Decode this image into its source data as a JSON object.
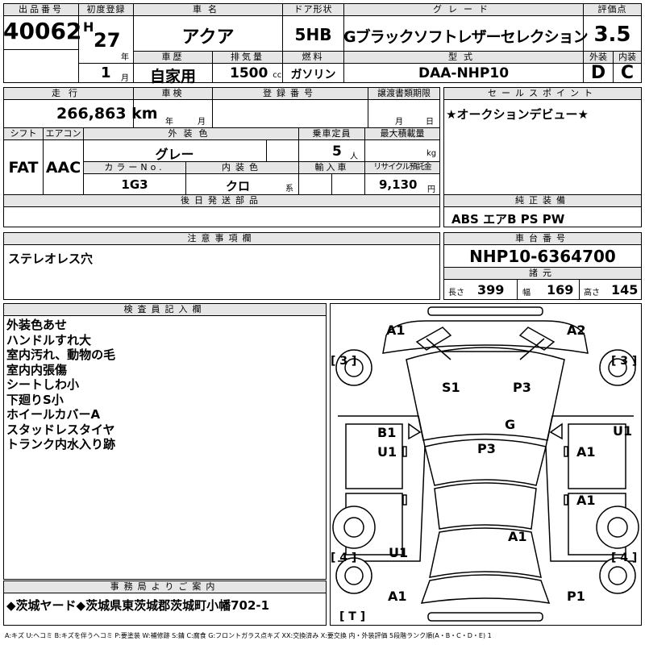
{
  "header": {
    "lot_label": "出品番号",
    "lot_no": "40062",
    "first_reg_label": "初度登録",
    "era": "H",
    "year": "27",
    "year_unit": "年",
    "month": "1",
    "month_unit": "月",
    "car_name_label": "車名",
    "car_name": "アクア",
    "door_label": "ドア形状",
    "door": "5HB",
    "grade_label": "グレード",
    "grade": "Gブラックソフトレザーセレクション",
    "score_label": "評価点",
    "score": "3.5",
    "history_label": "車歴",
    "history": "自家用",
    "displacement_label": "排気量",
    "displacement": "1500",
    "displacement_unit": "cc",
    "fuel_label": "燃料",
    "fuel": "ガソリン",
    "model_label": "型式",
    "model": "DAA-NHP10",
    "exterior_label": "外装",
    "exterior": "D",
    "interior_label": "内装",
    "interior": "C"
  },
  "row2": {
    "mileage_label": "走行",
    "mileage": "266,863",
    "mileage_unit": "km",
    "inspection_label": "車検",
    "insp_year_unit": "年",
    "insp_month_unit": "月",
    "plate_label": "登録番号",
    "transfer_label": "譲渡書類期限",
    "transfer_month_unit": "月",
    "transfer_day_unit": "日",
    "shift_label": "シフト",
    "shift": "FAT",
    "ac_label": "エアコン",
    "ac": "AAC",
    "color_label": "外装色",
    "color": "グレー",
    "capacity_label": "乗車定員",
    "capacity": "5",
    "capacity_unit": "人",
    "load_label": "最大積載量",
    "load_unit": "kg",
    "color_no_label": "カラーNo.",
    "color_no": "1G3",
    "int_color_label": "内装色",
    "int_color": "クロ",
    "int_color_unit": "系",
    "import_label": "輸入車",
    "recycle_label": "リサイクル預託金",
    "recycle": "9,130",
    "recycle_unit": "円",
    "later_label": "後日発送部品"
  },
  "sales": {
    "label": "セールスポイント",
    "text": "★オークションデビュー★"
  },
  "equipment": {
    "label": "純正装備",
    "text": "ABS エアB PS PW"
  },
  "notes": {
    "label": "注意事項欄",
    "text": "ステレオレス穴"
  },
  "chassis": {
    "label": "車台番号",
    "number": "NHP10-6364700",
    "spec_label": "諸元",
    "length_label": "長さ",
    "length": "399",
    "width_label": "幅",
    "width": "169",
    "height_label": "高さ",
    "height": "145"
  },
  "inspector": {
    "label": "検査員記入欄",
    "lines": [
      "外装色あせ",
      "ハンドルすれ大",
      "室内汚れ、動物の毛",
      "室内内張傷",
      "シートしわ小",
      "下廻りS小",
      "ホイールカバーA",
      "スタッドレスタイヤ",
      "トランク内水入り跡"
    ]
  },
  "office": {
    "label": "事務局よりご案内",
    "text": "◆茨城ヤード◆茨城県東茨城郡茨城町小幡702-1"
  },
  "diagram": {
    "marks": [
      "A1",
      "A2",
      "[ 3 ]",
      "[ 3 ]",
      "S1",
      "P3",
      "G",
      "B1",
      "U1",
      "P3",
      "U1",
      "A1",
      "A1",
      "A1",
      "U1",
      "[ 4 ]",
      "[ 4 ]",
      "A1",
      "P1",
      "[ T ]"
    ]
  },
  "legend": "A:キズ U:ヘコミ B:キズを伴うヘコミ P:要塗装 W:補修跡 S:錆 C:腐食 G:フロントガラス点キズ XX:交換済み X:要交換 内・外装評価 5段階ランク順(A・B・C・D・E) 1"
}
